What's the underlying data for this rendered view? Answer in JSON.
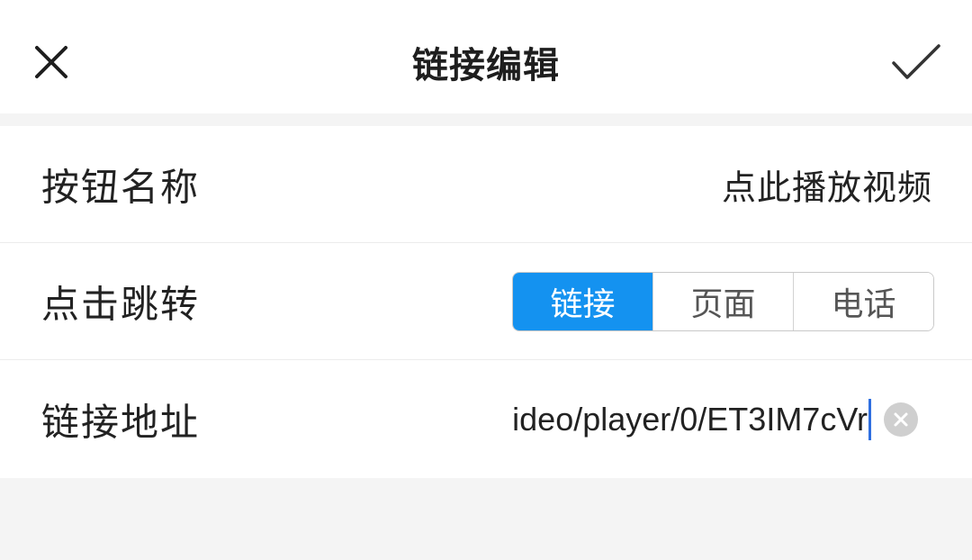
{
  "header": {
    "title": "链接编辑",
    "close_icon": "close-icon",
    "confirm_icon": "checkmark-icon"
  },
  "form": {
    "button_name": {
      "label": "按钮名称",
      "value": "点此播放视频"
    },
    "jump_type": {
      "label": "点击跳转",
      "options": [
        "链接",
        "页面",
        "电话"
      ],
      "selected": "链接"
    },
    "link_address": {
      "label": "链接地址",
      "value": "ideo/player/0/ET3IM7cVr",
      "clear_icon": "clear-circle-icon"
    }
  },
  "colors": {
    "accent": "#1492f0",
    "caret": "#2f6fe0"
  }
}
